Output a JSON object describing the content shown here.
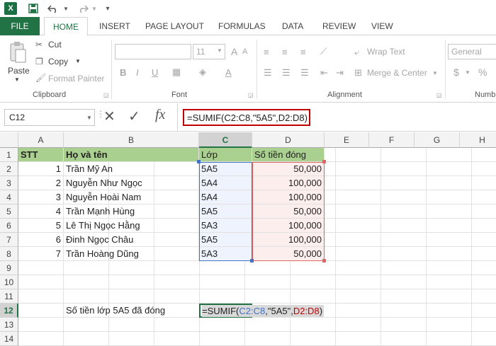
{
  "qat": {
    "excel_icon": "X"
  },
  "tabs": [
    {
      "id": "file",
      "label": "FILE"
    },
    {
      "id": "home",
      "label": "HOME"
    },
    {
      "id": "insert",
      "label": "INSERT"
    },
    {
      "id": "page_layout",
      "label": "PAGE LAYOUT"
    },
    {
      "id": "formulas",
      "label": "FORMULAS"
    },
    {
      "id": "data",
      "label": "DATA"
    },
    {
      "id": "review",
      "label": "REVIEW"
    },
    {
      "id": "view",
      "label": "VIEW"
    }
  ],
  "ribbon": {
    "clipboard": {
      "paste": "Paste",
      "cut": "Cut",
      "copy": "Copy",
      "format_painter": "Format Painter",
      "group": "Clipboard"
    },
    "font": {
      "font_size": "11",
      "bold": "B",
      "italic": "I",
      "underline": "U",
      "group": "Font"
    },
    "alignment": {
      "wrap_text": "Wrap Text",
      "merge_center": "Merge & Center",
      "group": "Alignment"
    },
    "number": {
      "format": "General",
      "currency": "$",
      "percent": "%",
      "group": "Numb"
    }
  },
  "formula_bar": {
    "name_box": "C12",
    "fx": "fx",
    "formula": "=SUMIF(C2:C8,\"5A5\",D2:D8)"
  },
  "columns": [
    "A",
    "B",
    "C",
    "D",
    "E",
    "F",
    "G",
    "H"
  ],
  "rows": [
    "1",
    "2",
    "3",
    "4",
    "5",
    "6",
    "7",
    "8",
    "9",
    "10",
    "11",
    "12",
    "13",
    "14"
  ],
  "sheet": {
    "header": {
      "a": "STT",
      "b": "Họ và tên",
      "c": "Lớp",
      "d": "Số tiền đóng"
    },
    "data": [
      {
        "a": "1",
        "b": "Trần Mỹ An",
        "c": "5A5",
        "d": "50,000"
      },
      {
        "a": "2",
        "b": "Nguyễn Như Ngọc",
        "c": "5A4",
        "d": "100,000"
      },
      {
        "a": "3",
        "b": "Nguyễn Hoài Nam",
        "c": "5A4",
        "d": "100,000"
      },
      {
        "a": "4",
        "b": "Trần Mạnh Hùng",
        "c": "5A5",
        "d": "50,000"
      },
      {
        "a": "5",
        "b": "Lê Thị Ngọc Hằng",
        "c": "5A3",
        "d": "100,000"
      },
      {
        "a": "6",
        "b": "Đinh Ngọc Châu",
        "c": "5A5",
        "d": "100,000"
      },
      {
        "a": "7",
        "b": "Trần Hoàng Dũng",
        "c": "5A3",
        "d": "50,000"
      }
    ],
    "label_b12": "Số tiền lớp 5A5 đã đóng",
    "formula_c12": {
      "p1": "=SUMIF(",
      "p2": "C2:C8",
      "p3": ",\"5A5\",",
      "p4": "D2:D8",
      "p5": ")"
    }
  },
  "colors": {
    "excel_green": "#217346",
    "header_fill": "#a9d08e",
    "ref_blue": "#4472c4",
    "ref_red": "#c00000"
  }
}
